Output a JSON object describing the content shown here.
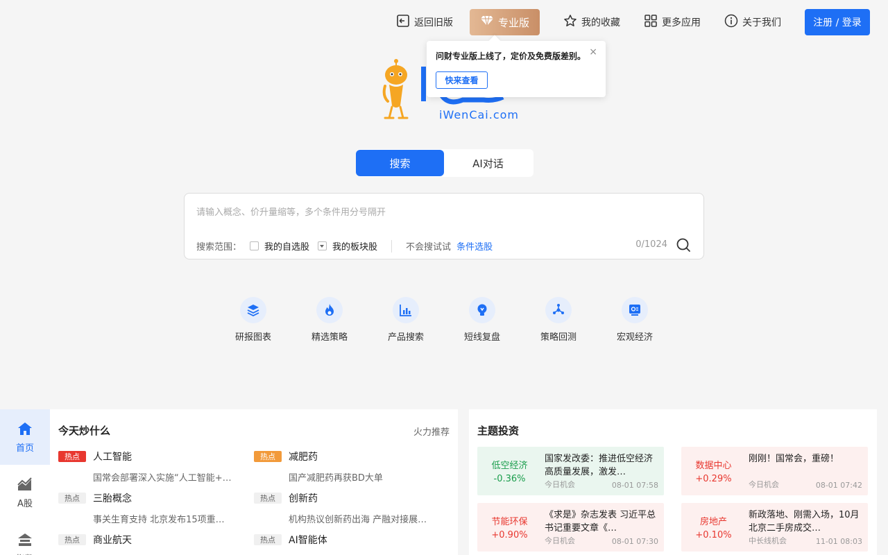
{
  "topnav": {
    "back_old": "返回旧版",
    "pro": "专业版",
    "favorites": "我的收藏",
    "more_apps": "更多应用",
    "about": "关于我们",
    "login": "注册 / 登录"
  },
  "popover": {
    "text": "问财专业版上线了，定价及免费版差别。",
    "button": "快来查看",
    "close": "×"
  },
  "logo": {
    "domain": "iWenCai.com"
  },
  "mode_tabs": {
    "search": "搜索",
    "ai_chat": "AI对话"
  },
  "search": {
    "placeholder": "请输入概念、价升量缩等，多个条件用分号隔开",
    "scope_label": "搜索范围：",
    "option1": "我的自选股",
    "option2": "我的板块股",
    "hint": "不会搜试试",
    "link": "条件选股",
    "counter": "0/1024"
  },
  "tools": [
    {
      "label": "研报图表",
      "icon": "layers-icon"
    },
    {
      "label": "精选策略",
      "icon": "flame-icon"
    },
    {
      "label": "产品搜索",
      "icon": "bar-chart-icon"
    },
    {
      "label": "短线复盘",
      "icon": "bulb-icon"
    },
    {
      "label": "策略回测",
      "icon": "network-icon"
    },
    {
      "label": "宏观经济",
      "icon": "monitor-icon"
    }
  ],
  "leftnav": [
    {
      "label": "首页",
      "icon": "home-icon"
    },
    {
      "label": "A股",
      "icon": "stock-chart-icon"
    },
    {
      "label": "指数",
      "icon": "index-icon"
    }
  ],
  "hot_panel": {
    "title": "今天炒什么",
    "more": "火力推荐",
    "items": [
      {
        "tag": "热点",
        "name": "人工智能",
        "desc": "国常会部署深入实施“人工智能+…"
      },
      {
        "tag": "热点",
        "name": "减肥药",
        "desc": "国产减肥药再获BD大单"
      },
      {
        "tag": "热点",
        "name": "三胎概念",
        "desc": "事关生育支持 北京发布15项重…"
      },
      {
        "tag": "热点",
        "name": "创新药",
        "desc": "机构热议创新药出海 产融对接展…"
      },
      {
        "tag": "热点",
        "name": "商业航天",
        "desc": ""
      },
      {
        "tag": "热点",
        "name": "AI智能体",
        "desc": ""
      }
    ]
  },
  "theme_panel": {
    "title": "主题投资",
    "cards": [
      {
        "name": "低空经济",
        "change": "-0.36%",
        "title": "国家发改委：推进低空经济高质量发展，激发…",
        "source": "今日机会",
        "time": "08-01 07:58",
        "color": "#1a9d4c"
      },
      {
        "name": "数据中心",
        "change": "+0.29%",
        "title": "刚刚！国常会，重磅！",
        "source": "今日机会",
        "time": "08-01 07:42",
        "color": "#e8372f"
      },
      {
        "name": "节能环保",
        "change": "+0.90%",
        "title": "《求是》杂志发表 习近平总书记重要文章《…",
        "source": "今日机会",
        "time": "08-01 07:30",
        "color": "#e8372f"
      },
      {
        "name": "房地产",
        "change": "+0.10%",
        "title": "新政落地、刚需入场，10月北京二手房成交…",
        "source": "中长线机会",
        "time": "11-01 08:03",
        "color": "#e8372f"
      }
    ]
  },
  "colors": {
    "accent": "#1e6ff5",
    "up": "#e8372f",
    "down": "#1a9d4c"
  }
}
